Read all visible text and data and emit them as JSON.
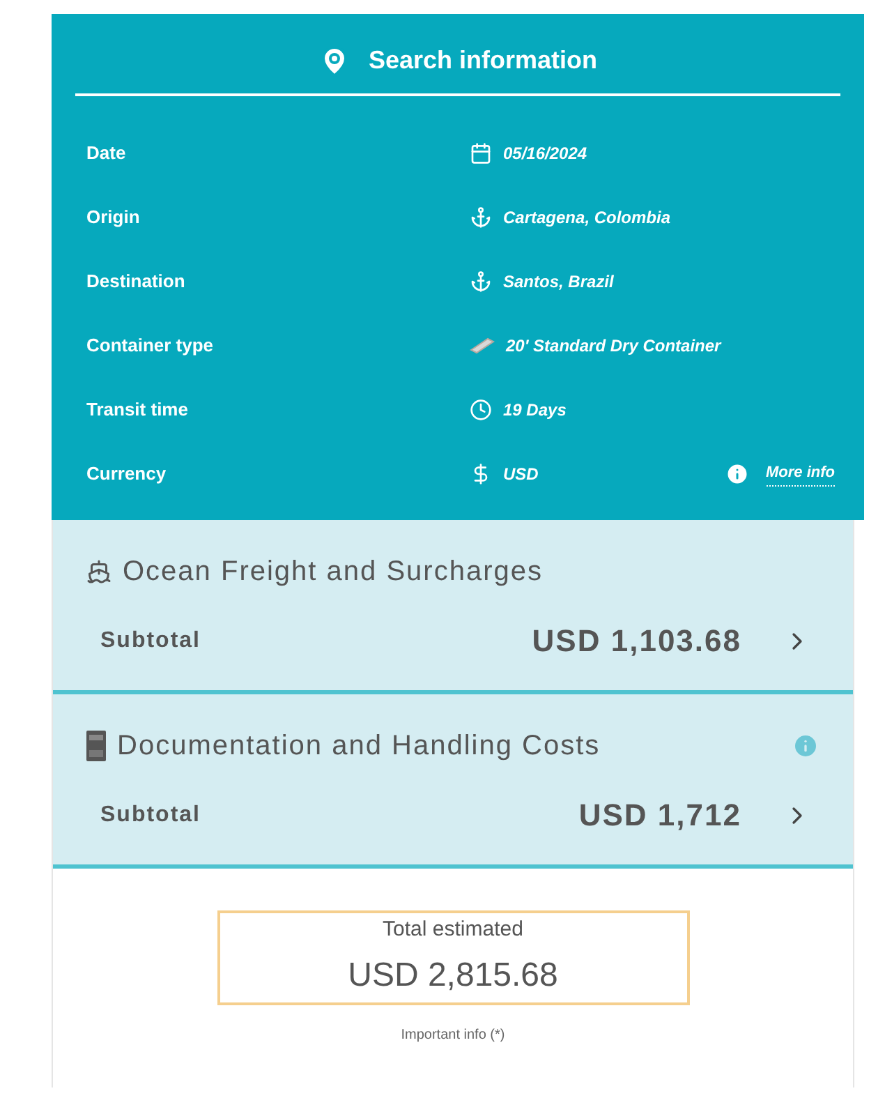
{
  "search_info": {
    "title": "Search information",
    "rows": [
      {
        "label": "Date",
        "kind": "calendar",
        "value": "05/16/2024"
      },
      {
        "label": "Origin",
        "kind": "anchor",
        "value": "Cartagena, Colombia"
      },
      {
        "label": "Destination",
        "kind": "anchor",
        "value": "Santos, Brazil"
      },
      {
        "label": "Container type",
        "kind": "container",
        "value": "20' Standard Dry Container"
      },
      {
        "label": "Transit time",
        "kind": "clock",
        "value": "19 Days"
      },
      {
        "label": "Currency",
        "kind": "dollar",
        "value": "USD",
        "link": "More info"
      }
    ]
  },
  "sections": [
    {
      "kind": "ship",
      "title": "Ocean Freight and Surcharges",
      "info": false,
      "subtotal_label": "Subtotal",
      "amount": "USD 1,103.68"
    },
    {
      "kind": "document",
      "title": "Documentation and Handling Costs",
      "info": true,
      "subtotal_label": "Subtotal",
      "amount": "USD 1,712"
    }
  ],
  "total": {
    "label": "Total estimated",
    "amount": "USD 2,815.68",
    "note": "Important info (*)"
  }
}
